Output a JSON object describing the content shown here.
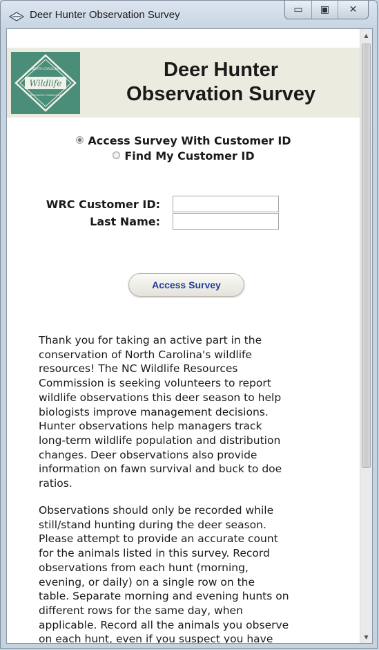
{
  "window": {
    "title": "Deer Hunter Observation Survey",
    "controls": {
      "minimize": "▭",
      "maximize": "▣",
      "close": "✕"
    }
  },
  "banner": {
    "logo": {
      "top": "NORTH CAROLINA",
      "script": "Wildlife",
      "bottom": "RESOURCES COMMISSION"
    },
    "title": "Deer Hunter\nObservation Survey"
  },
  "radios": [
    {
      "label": "Access Survey With Customer ID",
      "checked": true
    },
    {
      "label": "Find My Customer ID",
      "checked": false
    }
  ],
  "form": {
    "customer_id_label": "WRC Customer ID:",
    "customer_id_value": "",
    "last_name_label": "Last Name:",
    "last_name_value": ""
  },
  "button": {
    "label": "Access Survey"
  },
  "paragraphs": [
    "Thank you for taking an active part in the\nconservation of North Carolina's wildlife\nresources! The NC Wildlife Resources\nCommission is seeking volunteers to report\nwildlife observations this deer season to help\nbiologists improve management decisions.\nHunter observations help managers track\nlong-term wildlife population and distribution\nchanges. Deer observations also provide\ninformation on fawn survival and buck to doe\nratios.",
    "Observations should only be recorded while\nstill/stand hunting during the deer season.\nPlease attempt to provide an accurate count\nfor the animals listed in this survey. Record\nobservations from each hunt (morning,\nevening, or daily) on a single row on the\ntable. Separate morning and evening hunts on\ndifferent rows for the same day, when\napplicable. Record all the animals you observe\non each hunt, even if you suspect you have"
  ],
  "colors": {
    "banner_bg": "#ecebdf",
    "logo_bg": "#4a8d79",
    "button_text": "#1f3f9a"
  }
}
